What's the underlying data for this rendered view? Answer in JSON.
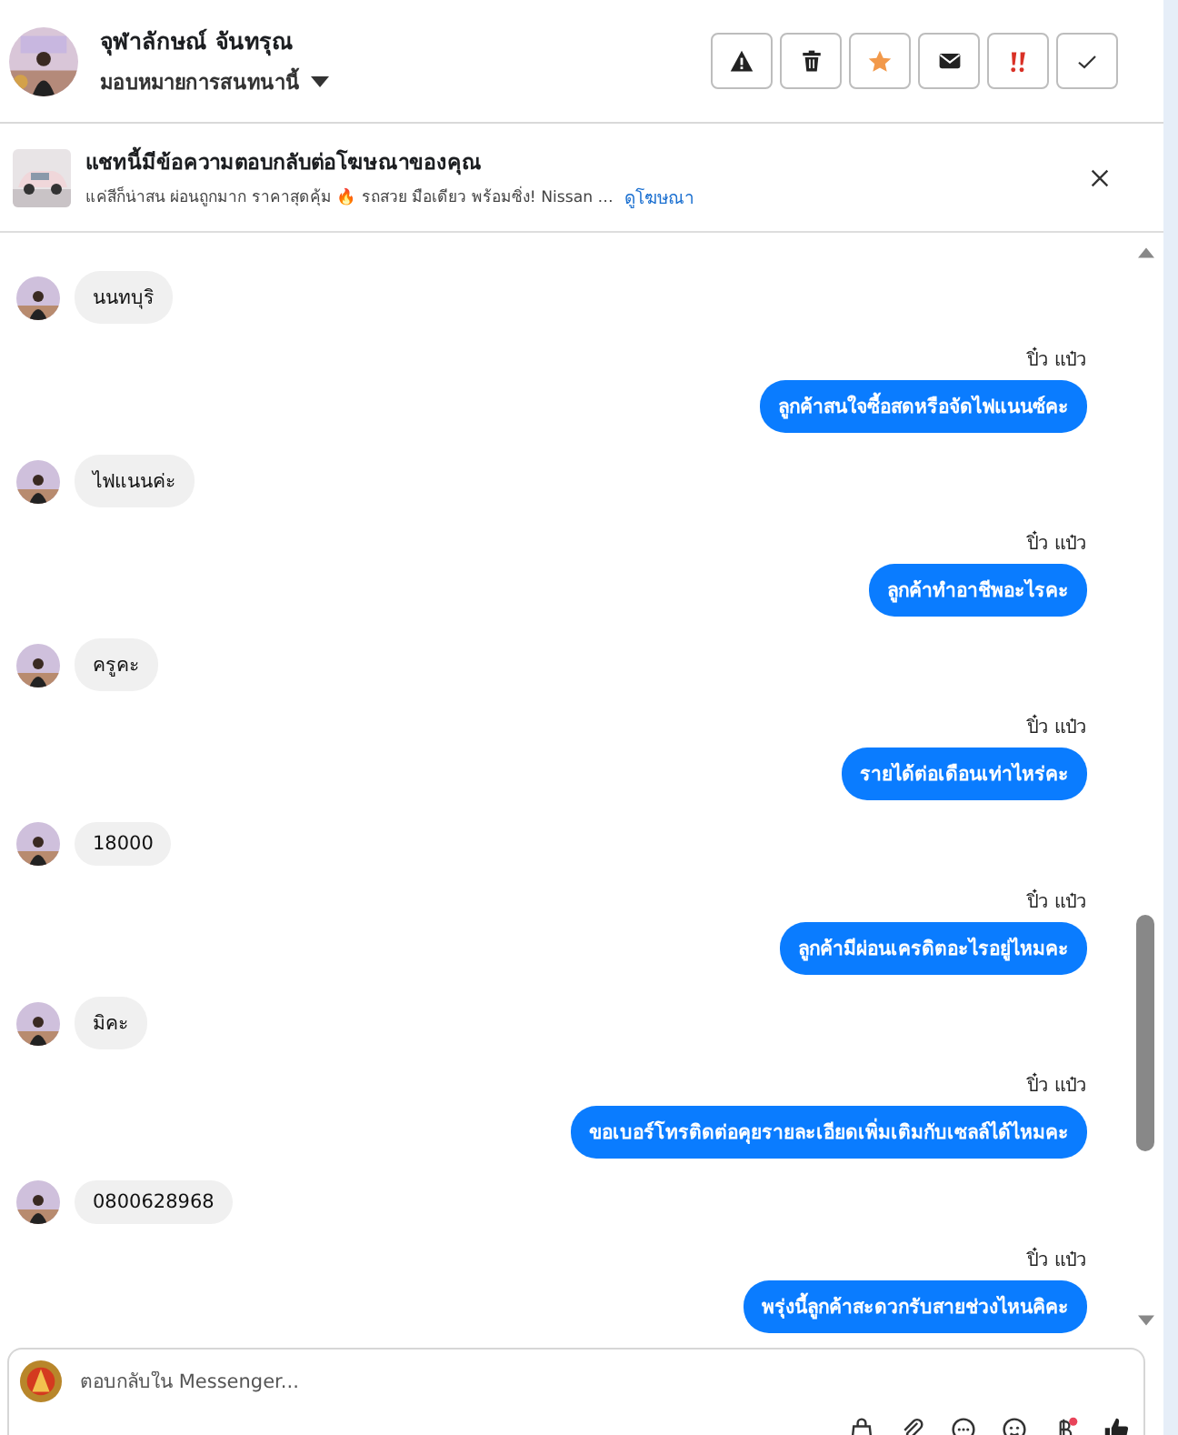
{
  "contact": {
    "name": "จุฬาลักษณ์ จันทรุณ",
    "assign": "มอบหมายการสนทนานี้"
  },
  "ad_notice": {
    "title": "แชทนี้มีข้อความตอบกลับต่อโฆษณาของคุณ",
    "text": "แค่สีก็น่าสน ผ่อนถูกมาก ราคาสุดคุ้ม 🔥 รถสวย มือเดียว พร้อมซิ่ง! Nissan …",
    "link": "ดูโฆษณา"
  },
  "messages": [
    {
      "kind": "in",
      "text": "นนทบุริ"
    },
    {
      "kind": "out",
      "sender": "ปิ๋ว แป๋ว",
      "text": "ลูกค้าสนใจซื้อสดหรือจัดไฟแนนซ์คะ"
    },
    {
      "kind": "in",
      "text": "ไฟแนนค่ะ"
    },
    {
      "kind": "out",
      "sender": "ปิ๋ว แป๋ว",
      "text": "ลูกค้าทำอาชีพอะไรคะ"
    },
    {
      "kind": "in",
      "text": "ครูคะ"
    },
    {
      "kind": "out",
      "sender": "ปิ๋ว แป๋ว",
      "text": "รายได้ต่อเดือนเท่าไหร่คะ"
    },
    {
      "kind": "in",
      "text": "18000"
    },
    {
      "kind": "out",
      "sender": "ปิ๋ว แป๋ว",
      "text": "ลูกค้ามีผ่อนเครดิตอะไรอยู่ไหมคะ"
    },
    {
      "kind": "in",
      "text": "มิคะ"
    },
    {
      "kind": "out",
      "sender": "ปิ๋ว แป๋ว",
      "text": "ขอเบอร์โทรติดต่อคุยรายละเอียดเพิ่มเติมกับเซลล์ได้ไหมคะ"
    },
    {
      "kind": "in",
      "text": "0800628968"
    },
    {
      "kind": "out",
      "sender": "ปิ๋ว แป๋ว",
      "text": "พรุ่งนี้ลูกค้าสะดวกรับสายช่วงไหนคิคะ"
    }
  ],
  "composer": {
    "placeholder": "ตอบกลับใน Messenger..."
  }
}
